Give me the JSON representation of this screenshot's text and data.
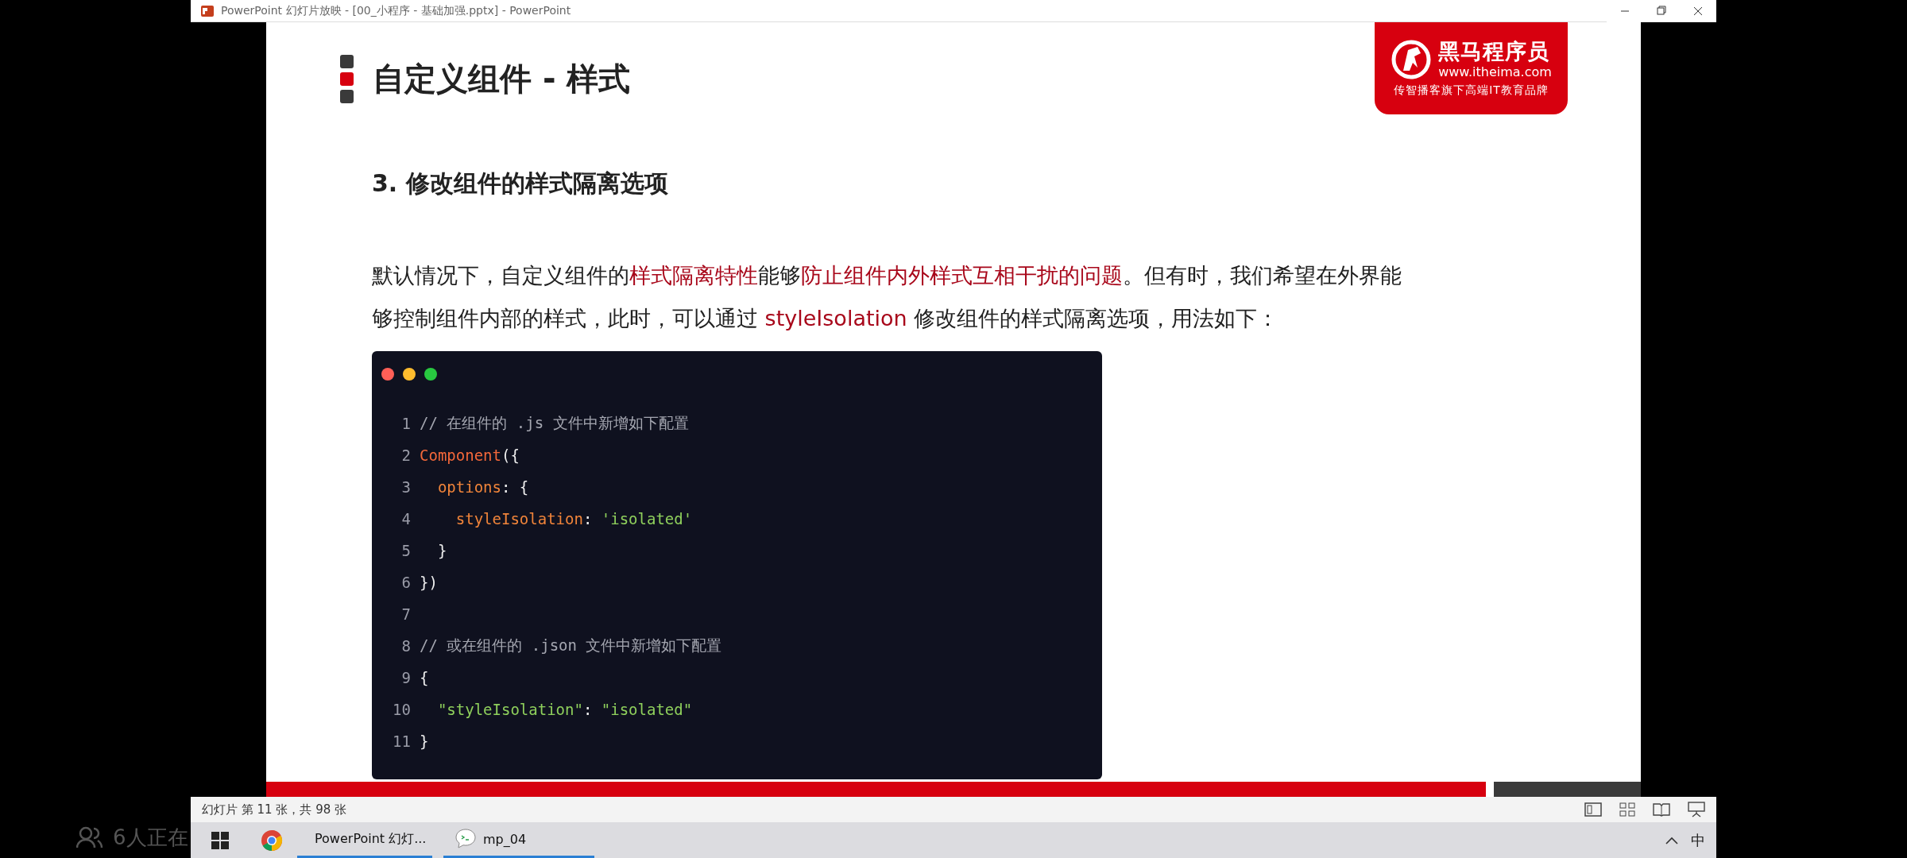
{
  "window": {
    "title": "PowerPoint 幻灯片放映 - [00_小程序 - 基础加强.pptx] - PowerPoint"
  },
  "slide": {
    "title": "自定义组件 - 样式",
    "logo": {
      "name": "黑马程序员",
      "url": "www.itheima.com",
      "tagline": "传智播客旗下高端IT教育品牌"
    },
    "heading": "3. 修改组件的样式隔离选项",
    "paragraph": [
      {
        "text": "默认情况下，自定义组件的",
        "highlight": false
      },
      {
        "text": "样式隔离特性",
        "highlight": true
      },
      {
        "text": "能够",
        "highlight": false
      },
      {
        "text": "防止组件内外样式互相干扰的问题",
        "highlight": true
      },
      {
        "text": "。但有时，我们希望在外界能够控制组件内部的样式，此时，可以通过 ",
        "highlight": false
      },
      {
        "text": "styleIsolation",
        "highlight": true
      },
      {
        "text": " 修改组件的样式隔离选项，用法如下：",
        "highlight": false
      }
    ],
    "code": [
      {
        "number": "1",
        "tokens": [
          {
            "text": "// 在组件的 .js 文件中新增如下配置",
            "kind": "comment"
          }
        ]
      },
      {
        "number": "2",
        "tokens": [
          {
            "text": "Component",
            "kind": "function"
          },
          {
            "text": "({",
            "kind": "punct"
          }
        ]
      },
      {
        "number": "3",
        "tokens": [
          {
            "text": "  options",
            "kind": "property"
          },
          {
            "text": ": {",
            "kind": "punct"
          }
        ]
      },
      {
        "number": "4",
        "tokens": [
          {
            "text": "    styleIsolation",
            "kind": "property"
          },
          {
            "text": ": ",
            "kind": "punct"
          },
          {
            "text": "'isolated'",
            "kind": "string"
          }
        ]
      },
      {
        "number": "5",
        "tokens": [
          {
            "text": "  }",
            "kind": "punct"
          }
        ]
      },
      {
        "number": "6",
        "tokens": [
          {
            "text": "})",
            "kind": "punct"
          }
        ]
      },
      {
        "number": "7"
      },
      {
        "number": "8",
        "tokens": [
          {
            "text": "// 或在组件的 .json 文件中新增如下配置",
            "kind": "comment"
          }
        ]
      },
      {
        "number": "9",
        "tokens": [
          {
            "text": "{",
            "kind": "punct"
          }
        ]
      },
      {
        "number": "10",
        "tokens": [
          {
            "text": "  \"styleIsolation\"",
            "kind": "string"
          },
          {
            "text": ": ",
            "kind": "punct"
          },
          {
            "text": "\"isolated\"",
            "kind": "string"
          }
        ]
      },
      {
        "number": "11",
        "tokens": [
          {
            "text": "}",
            "kind": "punct"
          }
        ]
      }
    ]
  },
  "status_bar": {
    "text": "幻灯片 第 11 张，共 98 张"
  },
  "taskbar": {
    "apps": [
      {
        "kind": "powerpoint",
        "label": "PowerPoint 幻灯..."
      },
      {
        "kind": "terminal",
        "label": "mp_04"
      }
    ],
    "ime": "中"
  },
  "overlay": {
    "viewers": "6人正在"
  }
}
